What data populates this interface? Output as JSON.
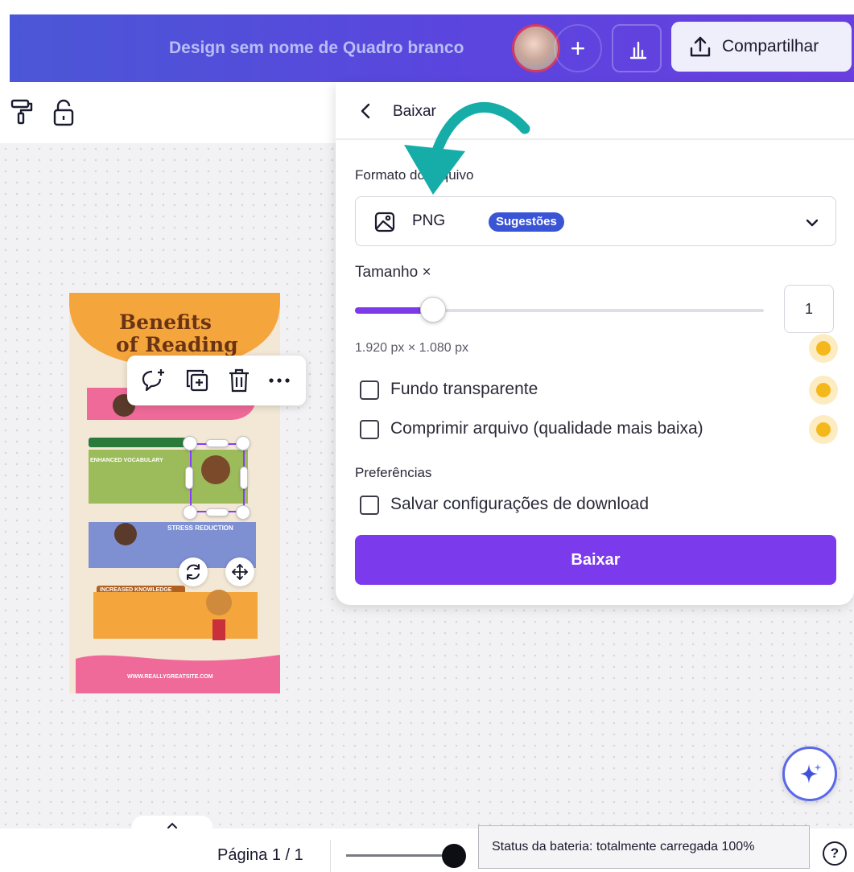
{
  "header": {
    "doc_title": "Design sem nome de Quadro branco",
    "add_label": "+",
    "share_label": "Compartilhar"
  },
  "toolbar": {
    "icons": [
      "paint-roller-icon",
      "lock-icon"
    ]
  },
  "design": {
    "title_line1": "Benefits",
    "title_line2": "of Reading",
    "sections": [
      "ENHANCED VOCABULARY",
      "STRESS REDUCTION",
      "INCREASED KNOWLEDGE"
    ],
    "website": "WWW.REALLYGREATSITE.COM",
    "colors": {
      "orange": "#f4a53c",
      "pink": "#ef6a98",
      "green": "#9cbb5a",
      "blue": "#7e8fd2",
      "cream": "#f3e8d6"
    }
  },
  "download_panel": {
    "title": "Baixar",
    "format_label": "Formato do arquivo",
    "format_value": "PNG",
    "format_badge": "Sugestões",
    "size_label": "Tamanho ×",
    "size_value": "1",
    "size_slider_fraction": 0.19,
    "dimensions": "1.920 px × 1.080 px",
    "transparent_bg_label": "Fundo transparente",
    "compress_label": "Comprimir arquivo (qualidade mais baixa)",
    "preferences_label": "Preferências",
    "save_settings_label": "Salvar configurações de download",
    "download_button": "Baixar",
    "accent_color": "#7c3aed"
  },
  "footer": {
    "page_label": "Página 1 / 1",
    "tooltip": "Status da bateria: totalmente carregada 100%",
    "help": "?"
  }
}
